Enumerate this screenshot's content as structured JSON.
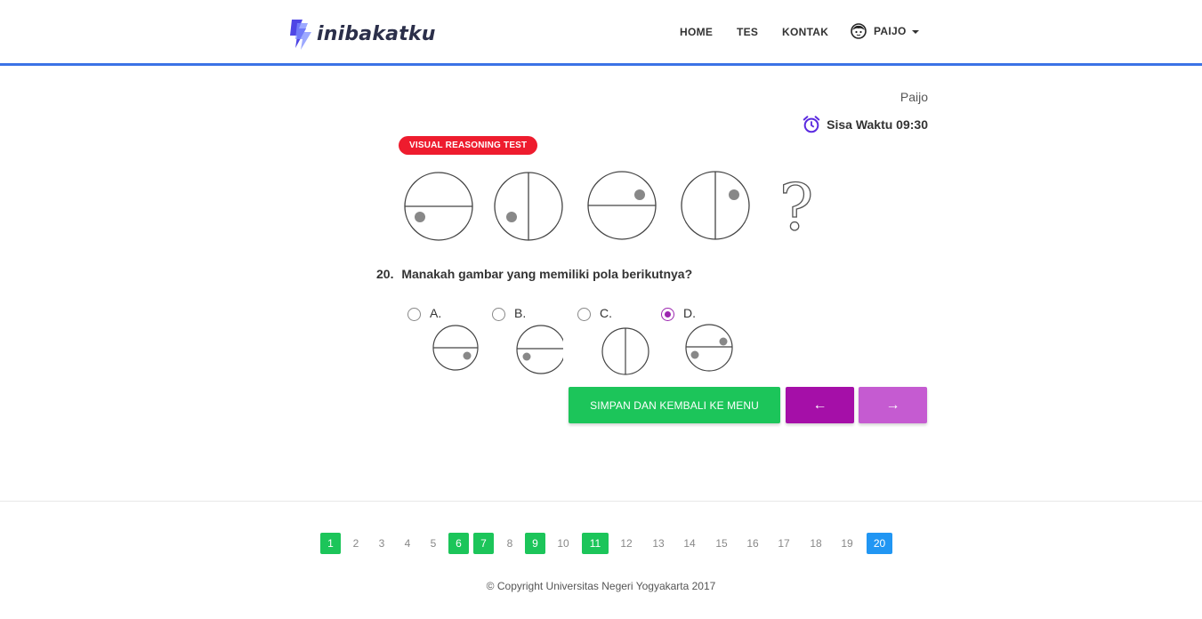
{
  "brand": {
    "name": "inibakatku"
  },
  "nav": {
    "home": "HOME",
    "tes": "TES",
    "kontak": "KONTAK",
    "user": "PAIJO"
  },
  "header": {
    "username": "Paijo",
    "timer_label": "Sisa Waktu 09:30"
  },
  "test": {
    "badge": "VISUAL REASONING TEST",
    "question_number": "20.",
    "question_text": "Manakah gambar yang memiliki pola berikutnya?",
    "sequence_end": "?",
    "options": [
      {
        "label": "A.",
        "selected": false
      },
      {
        "label": "B.",
        "selected": false
      },
      {
        "label": "C.",
        "selected": false
      },
      {
        "label": "D.",
        "selected": true
      }
    ]
  },
  "buttons": {
    "save": "SIMPAN DAN KEMBALI KE MENU",
    "prev": "←",
    "next": "→"
  },
  "pagination": {
    "pages": [
      "1",
      "2",
      "3",
      "4",
      "5",
      "6",
      "7",
      "8",
      "9",
      "10",
      "11",
      "12",
      "13",
      "14",
      "15",
      "16",
      "17",
      "18",
      "19",
      "20"
    ],
    "answered": [
      "1",
      "6",
      "7",
      "9",
      "11"
    ],
    "current": "20"
  },
  "footer": {
    "copyright": "© Copyright Universitas Negeri Yogyakarta 2017"
  },
  "colors": {
    "accent": "#3b73e6",
    "green": "#1cc55a",
    "purple": "#a50fa8",
    "purple_light": "#c55bd1",
    "badge": "#ee1c2e",
    "current_page": "#2196f3"
  }
}
